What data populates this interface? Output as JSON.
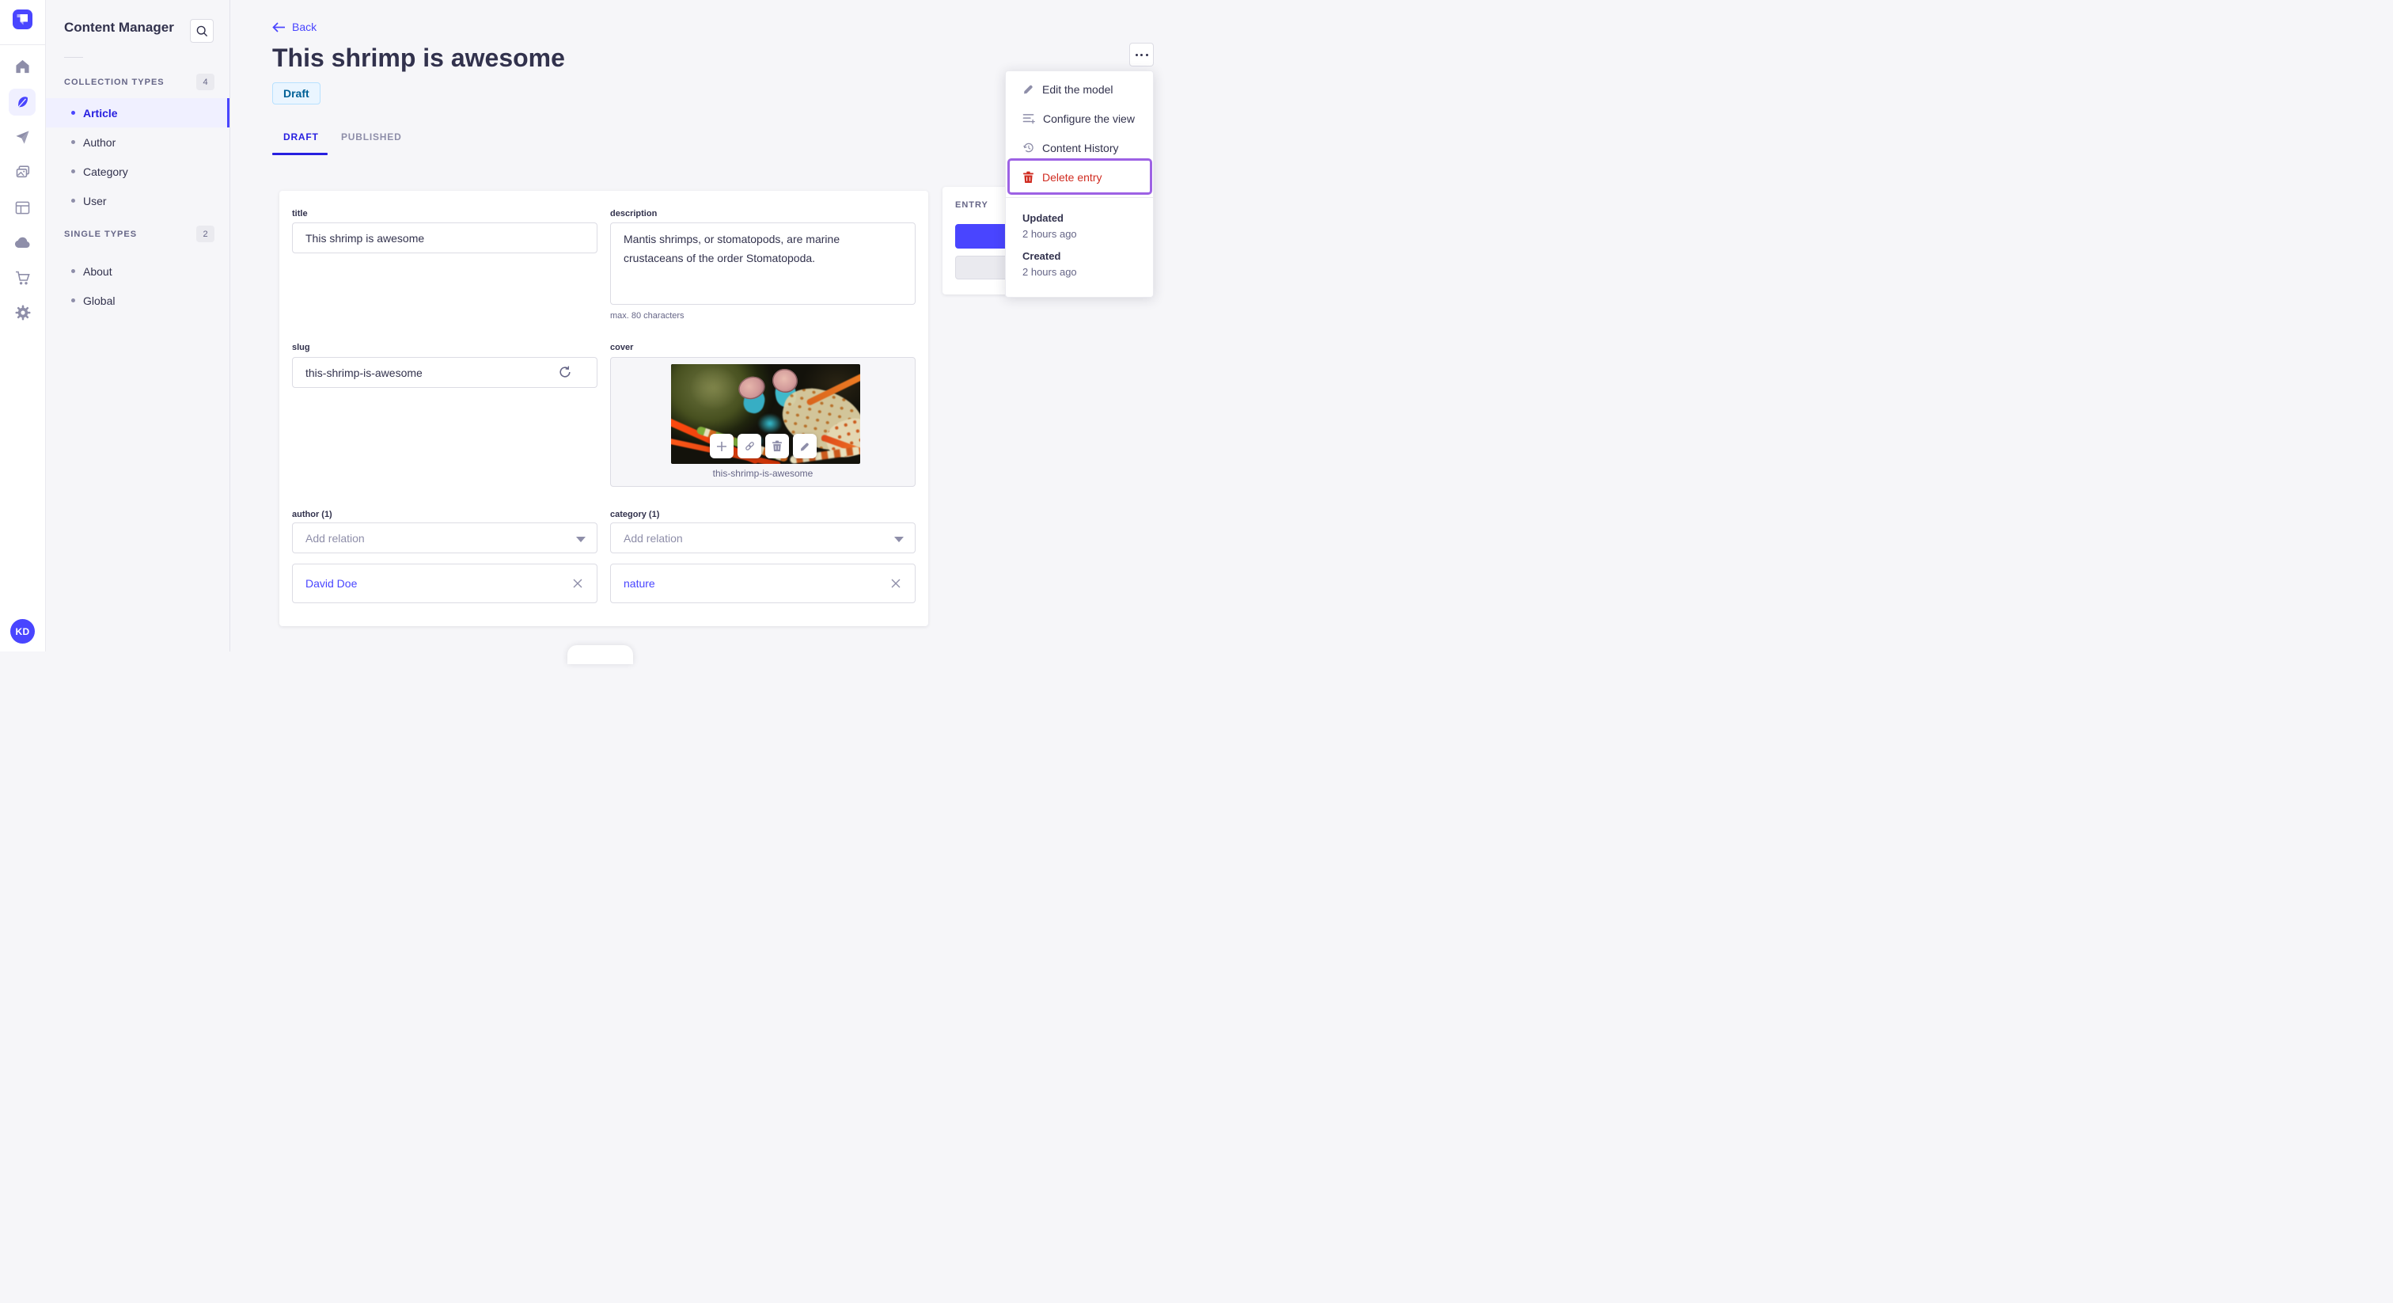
{
  "rail": {
    "logo_icon": "strapi-logo",
    "icons": [
      "home-icon",
      "content-manager-feather-icon",
      "send-plane-icon",
      "media-images-icon",
      "layout-icon",
      "cloud-icon",
      "cart-icon",
      "gear-icon"
    ],
    "avatar_initials": "KD"
  },
  "nav": {
    "title": "Content Manager",
    "search_icon": "search-icon",
    "collection": {
      "label": "COLLECTION TYPES",
      "count": "4",
      "items": [
        "Article",
        "Author",
        "Category",
        "User"
      ],
      "active_item": "Article"
    },
    "single": {
      "label": "SINGLE TYPES",
      "count": "2",
      "items": [
        "About",
        "Global"
      ]
    }
  },
  "header": {
    "back_label": "Back",
    "title": "This shrimp is awesome",
    "status_badge": "Draft"
  },
  "tabs": {
    "draft": "DRAFT",
    "published": "PUBLISHED"
  },
  "form": {
    "title": {
      "label": "title",
      "value": "This shrimp is awesome"
    },
    "description": {
      "label": "description",
      "value": "Mantis shrimps, or stomatopods, are marine crustaceans of the order Stomatopoda.",
      "hint": "max. 80 characters"
    },
    "slug": {
      "label": "slug",
      "value": "this-shrimp-is-awesome",
      "regenerate_icon": "refresh-icon"
    },
    "cover": {
      "label": "cover",
      "caption": "this-shrimp-is-awesome",
      "action_icons": [
        "plus-icon",
        "link-icon",
        "trash-icon",
        "pencil-icon"
      ]
    },
    "author": {
      "label": "author (1)",
      "placeholder": "Add relation",
      "relation": "David Doe"
    },
    "category": {
      "label": "category (1)",
      "placeholder": "Add relation",
      "relation": "nature"
    }
  },
  "entry_panel": {
    "title": "ENTRY"
  },
  "menu": {
    "items": [
      "Edit the model",
      "Configure the view",
      "Content History",
      "Delete entry"
    ],
    "item_icons": [
      "pencil-icon",
      "configure-list-icon",
      "history-clock-icon",
      "trash-icon"
    ],
    "updated_label": "Updated",
    "updated_value": "2 hours ago",
    "created_label": "Created",
    "created_value": "2 hours ago"
  },
  "colors": {
    "accent": "#4945FF",
    "accent_dark": "#271FE0",
    "accent_light_bg": "#F0F0FF",
    "danger": "#D02B20",
    "highlight_ring": "#9D62E4",
    "draft_badge_bg": "#EAF5FF",
    "draft_badge_border": "#B8E1FF",
    "draft_badge_text": "#006096",
    "page_bg": "#F6F6F9",
    "border": "#DCDCE4",
    "muted_text": "#666687",
    "icon_gray": "#8E8EA9"
  }
}
